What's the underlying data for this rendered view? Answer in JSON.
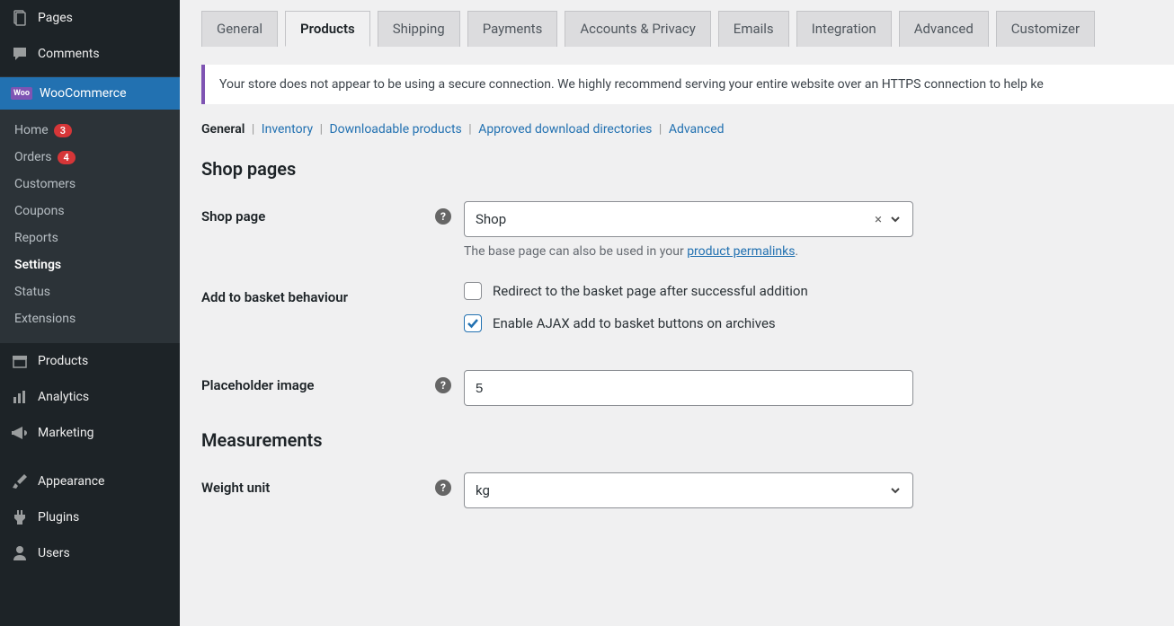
{
  "sidebar": {
    "top": [
      {
        "label": "Pages",
        "icon": "pages"
      },
      {
        "label": "Comments",
        "icon": "comment"
      }
    ],
    "woo_label": "WooCommerce",
    "woo_sub": [
      {
        "label": "Home",
        "badge": "3"
      },
      {
        "label": "Orders",
        "badge": "4"
      },
      {
        "label": "Customers"
      },
      {
        "label": "Coupons"
      },
      {
        "label": "Reports"
      },
      {
        "label": "Settings",
        "current": true
      },
      {
        "label": "Status"
      },
      {
        "label": "Extensions"
      }
    ],
    "bottom": [
      {
        "label": "Products",
        "icon": "archive"
      },
      {
        "label": "Analytics",
        "icon": "analytics"
      },
      {
        "label": "Marketing",
        "icon": "megaphone"
      },
      {
        "label": "Appearance",
        "icon": "brush",
        "gap": true
      },
      {
        "label": "Plugins",
        "icon": "plugin"
      },
      {
        "label": "Users",
        "icon": "user"
      }
    ]
  },
  "tabs": [
    "General",
    "Products",
    "Shipping",
    "Payments",
    "Accounts & Privacy",
    "Emails",
    "Integration",
    "Advanced",
    "Customizer"
  ],
  "active_tab": "Products",
  "notice": "Your store does not appear to be using a secure connection. We highly recommend serving your entire website over an HTTPS connection to help ke",
  "subtabs": {
    "current": "General",
    "items": [
      "Inventory",
      "Downloadable products",
      "Approved download directories",
      "Advanced"
    ]
  },
  "sections": {
    "shop_pages": "Shop pages",
    "measurements": "Measurements"
  },
  "fields": {
    "shop_page": {
      "label": "Shop page",
      "value": "Shop",
      "desc_prefix": "The base page can also be used in your ",
      "desc_link": "product permalinks",
      "desc_suffix": "."
    },
    "add_to_basket": {
      "label": "Add to basket behaviour",
      "opt1": "Redirect to the basket page after successful addition",
      "opt2": "Enable AJAX add to basket buttons on archives"
    },
    "placeholder_image": {
      "label": "Placeholder image",
      "value": "5"
    },
    "weight_unit": {
      "label": "Weight unit",
      "value": "kg"
    }
  }
}
